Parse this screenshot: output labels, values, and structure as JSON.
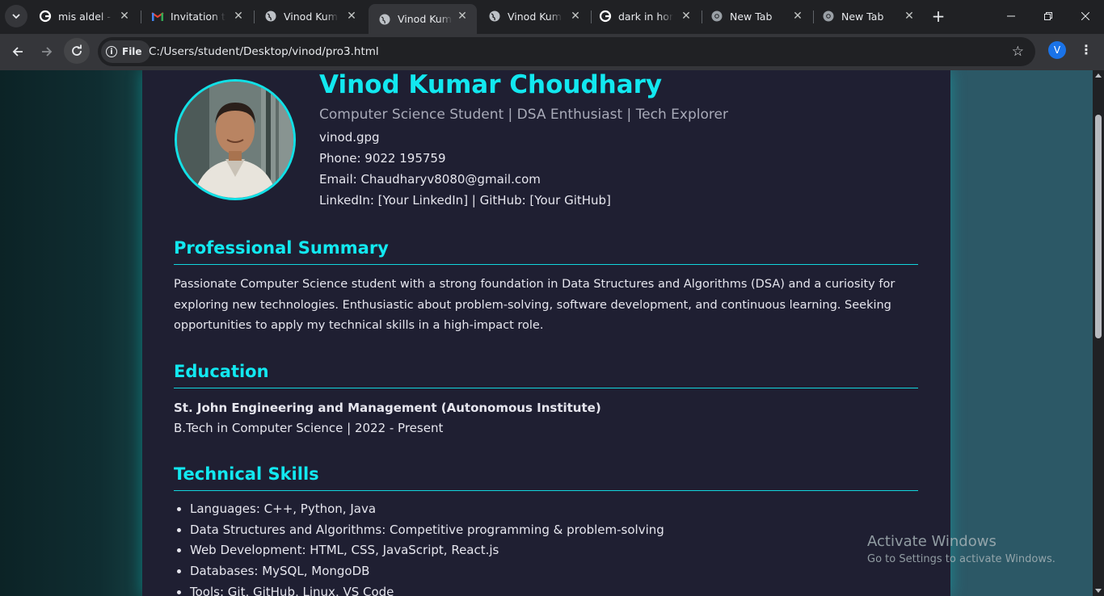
{
  "browser": {
    "tabs": [
      {
        "title": "mis aldel - Go",
        "icon": "google-icon"
      },
      {
        "title": "Invitation to",
        "icon": "gmail-icon"
      },
      {
        "title": "Vinod Kumar",
        "icon": "globe-icon"
      },
      {
        "title": "Vinod Kumar",
        "icon": "globe-icon",
        "active": true
      },
      {
        "title": "Vinod Kumar",
        "icon": "globe-icon"
      },
      {
        "title": "dark in horse",
        "icon": "google-icon"
      },
      {
        "title": "New Tab",
        "icon": "chrome-icon"
      },
      {
        "title": "New Tab",
        "icon": "chrome-icon"
      }
    ],
    "address": {
      "scheme_chip": "File",
      "url": "C:/Users/student/Desktop/vinod/pro3.html"
    },
    "profile_initial": "V"
  },
  "page": {
    "name": "Vinod Kumar Choudhary",
    "tagline": "Computer Science Student | DSA Enthusiast | Tech Explorer",
    "contact": {
      "photo_text": "vinod.gpg",
      "phone": "Phone: 9022 195759",
      "email": "Email: Chaudharyv8080@gmail.com",
      "links": "LinkedIn: [Your LinkedIn] | GitHub: [Your GitHub]"
    },
    "summary": {
      "heading": "Professional Summary",
      "text": "Passionate Computer Science student with a strong foundation in Data Structures and Algorithms (DSA) and a curiosity for exploring new technologies. Enthusiastic about problem-solving, software development, and continuous learning. Seeking opportunities to apply my technical skills in a high-impact role."
    },
    "education": {
      "heading": "Education",
      "school": "St. John Engineering and Management (Autonomous Institute)",
      "degree": "B.Tech in Computer Science | 2022 - Present"
    },
    "skills": {
      "heading": "Technical Skills",
      "items": [
        "Languages: C++, Python, Java",
        "Data Structures and Algorithms: Competitive programming & problem-solving",
        "Web Development: HTML, CSS, JavaScript, React.js",
        "Databases: MySQL, MongoDB",
        "Tools: Git, GitHub, Linux, VS Code"
      ]
    }
  },
  "watermark": {
    "line1": "Activate Windows",
    "line2": "Go to Settings to activate Windows."
  },
  "colors": {
    "accent": "#12e8f0",
    "card_bg": "#1f1f32",
    "chrome_bg": "#202124",
    "toolbar_bg": "#35363a"
  }
}
